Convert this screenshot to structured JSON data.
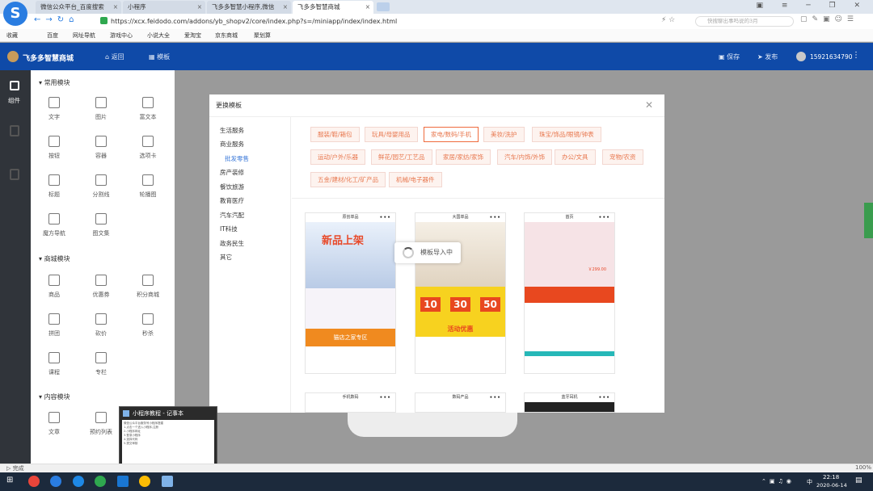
{
  "browser": {
    "logo": "S",
    "tabs": [
      {
        "title": "微信公众平台_百度搜索"
      },
      {
        "title": "小程序"
      },
      {
        "title": "飞多多智慧小程序,微信"
      },
      {
        "title": "飞多多智慧商城"
      }
    ],
    "url": "https://xcx.feidodo.com/addons/yb_shopv2/core/index.php?s=/miniapp/index/index.html",
    "search_placeholder": "快搜聊出事吗说的3月",
    "bookmarks": [
      "收藏",
      "百度",
      "网址导航",
      "游戏中心",
      "小说大全",
      "爱淘宝",
      "京东商城",
      "聚划算"
    ],
    "status_text": "完成",
    "zoom": "100%"
  },
  "app": {
    "brand": "飞多多智慧商城",
    "nav": [
      "返回",
      "模板"
    ],
    "save": "保存",
    "publish": "发布",
    "phone": "15921634790",
    "sidebar_item": "组件",
    "sections": [
      {
        "title": "常用模块",
        "items": [
          "文字",
          "图片",
          "富文本",
          "按钮",
          "容器",
          "选项卡",
          "标题",
          "分割线",
          "轮播图",
          "魔方导航",
          "图文集"
        ]
      },
      {
        "title": "商城模块",
        "items": [
          "商品",
          "优惠券",
          "积分商城",
          "拼团",
          "砍价",
          "秒杀",
          "课程",
          "专栏"
        ]
      },
      {
        "title": "内容模块",
        "items": [
          "文章",
          "预约列表"
        ]
      }
    ]
  },
  "modal": {
    "title": "更换模板",
    "categories": [
      "生活服务",
      "商业服务",
      "批发零售",
      "房产装修",
      "餐饮旅游",
      "教育医疗",
      "汽车汽配",
      "IT科技",
      "政务民生",
      "其它"
    ],
    "tags": [
      "服装/鞋/箱包",
      "玩具/母婴用品",
      "家电/数码/手机",
      "美妆/洗护",
      "珠宝/饰品/眼镜/钟表",
      "运动/户外/乐器",
      "鲜花/园艺/工艺品",
      "家居/家纺/家饰",
      "汽车/内饰/外饰",
      "办公/文具",
      "宠物/农资",
      "五金/建材/化工/矿产品",
      "机械/电子器件"
    ],
    "selected_tag": "家电/数码/手机",
    "cards": [
      {
        "header": "原创单品",
        "banner": "新品上架",
        "sub": "猫店之家专区"
      },
      {
        "header": "大国单品",
        "prices": [
          "10",
          "30",
          "50"
        ],
        "sub": "活动优惠"
      },
      {
        "header": "首页",
        "sub": "￥299.00"
      },
      {
        "header": "手机数码"
      },
      {
        "header": "数码产品"
      },
      {
        "header": "蓝牙耳机"
      }
    ],
    "loading_text": "模板导入中"
  },
  "notepad": {
    "title": "小程序教程 - 记事本",
    "lines": [
      "微信公众平台服务号小程序搭建",
      "1.点击一个进入小程序,注册",
      "2.小程序网址",
      "3.登录小程序",
      "4.选择代码",
      "5.提交审核"
    ]
  },
  "taskbar": {
    "time": "22:18",
    "date": "2020-06-14",
    "ime": "中"
  },
  "colors": {
    "header": "#0f4aa8",
    "accent": "#ef6b3d",
    "sidebar": "#30343a"
  }
}
